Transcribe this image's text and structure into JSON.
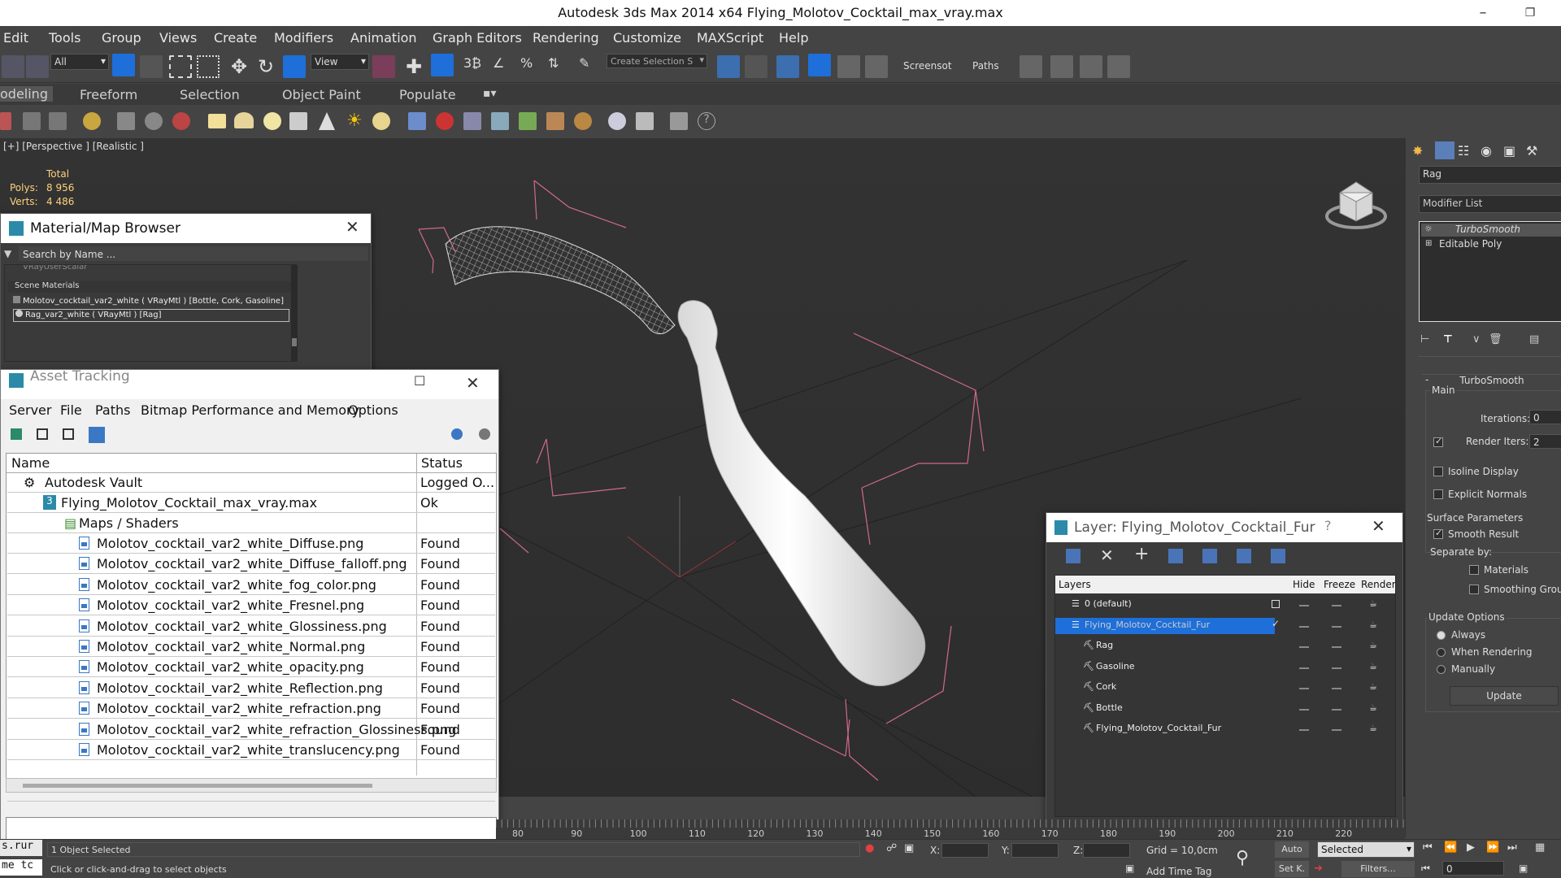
{
  "window": {
    "title": "Autodesk 3ds Max  2014 x64      Flying_Molotov_Cocktail_max_vray.max"
  },
  "menu": [
    "Edit",
    "Tools",
    "Group",
    "Views",
    "Create",
    "Modifiers",
    "Animation",
    "Graph Editors",
    "Rendering",
    "Customize",
    "MAXScript",
    "Help"
  ],
  "toolbar": {
    "filter": "All",
    "ref_coord": "View",
    "selection_set_placeholder": "Create Selection S",
    "screenshot_label": "Screensot",
    "paths_label": "Paths"
  },
  "ribbon_tabs": [
    "odeling",
    "Freeform",
    "Selection",
    "Object Paint",
    "Populate"
  ],
  "viewport": {
    "label": "[+] [Perspective ] [Realistic ]",
    "stats_total": "Total",
    "polys_label": "Polys:",
    "polys": "8 956",
    "verts_label": "Verts:",
    "verts": "4 486"
  },
  "material_browser": {
    "title": "Material/Map Browser",
    "search_placeholder": "Search by Name ...",
    "truncated_item": "VRayUserScalar",
    "group": "Scene Materials",
    "items": [
      "Molotov_cocktail_var2_white ( VRayMtl ) [Bottle, Cork, Gasoline]",
      "Rag_var2_white ( VRayMtl ) [Rag]"
    ]
  },
  "asset_tracking": {
    "title": "Asset Tracking",
    "menu": [
      "Server",
      "File",
      "Paths",
      "Bitmap Performance and Memory",
      "Options"
    ],
    "col_name": "Name",
    "col_status": "Status",
    "vault": {
      "name": "Autodesk Vault",
      "status": "Logged O..."
    },
    "file": {
      "name": "Flying_Molotov_Cocktail_max_vray.max",
      "status": "Ok"
    },
    "group": "Maps / Shaders",
    "maps": [
      {
        "name": "Molotov_cocktail_var2_white_Diffuse.png",
        "status": "Found"
      },
      {
        "name": "Molotov_cocktail_var2_white_Diffuse_falloff.png",
        "status": "Found"
      },
      {
        "name": "Molotov_cocktail_var2_white_fog_color.png",
        "status": "Found"
      },
      {
        "name": "Molotov_cocktail_var2_white_Fresnel.png",
        "status": "Found"
      },
      {
        "name": "Molotov_cocktail_var2_white_Glossiness.png",
        "status": "Found"
      },
      {
        "name": "Molotov_cocktail_var2_white_Normal.png",
        "status": "Found"
      },
      {
        "name": "Molotov_cocktail_var2_white_opacity.png",
        "status": "Found"
      },
      {
        "name": "Molotov_cocktail_var2_white_Reflection.png",
        "status": "Found"
      },
      {
        "name": "Molotov_cocktail_var2_white_refraction.png",
        "status": "Found"
      },
      {
        "name": "Molotov_cocktail_var2_white_refraction_Glossiness.png",
        "status": "Found"
      },
      {
        "name": "Molotov_cocktail_var2_white_translucency.png",
        "status": "Found"
      }
    ]
  },
  "layer_dialog": {
    "title": "Layer: Flying_Molotov_Cocktail_Fur",
    "help": "?",
    "col_layers": "Layers",
    "col_hide": "Hide",
    "col_freeze": "Freeze",
    "col_render": "Render",
    "layers": [
      "0 (default)",
      "Flying_Molotov_Cocktail_Fur",
      "Rag",
      "Gasoline",
      "Cork",
      "Bottle",
      "Flying_Molotov_Cocktail_Fur"
    ]
  },
  "command_panel": {
    "object_name": "Rag",
    "modifier_list": "Modifier List",
    "stack": [
      "TurboSmooth",
      "Editable Poly"
    ],
    "rollout_title": "TurboSmooth",
    "main": "Main",
    "iterations_label": "Iterations:",
    "iterations": "0",
    "render_iters_label": "Render Iters:",
    "render_iters": "2",
    "isoline": "Isoline Display",
    "explicit_normals": "Explicit Normals",
    "surface_params": "Surface Parameters",
    "smooth_result": "Smooth Result",
    "separate_by": "Separate by:",
    "materials": "Materials",
    "smoothing_groups": "Smoothing Groups",
    "update_options": "Update Options",
    "always": "Always",
    "when_rendering": "When Rendering",
    "manually": "Manually",
    "update_button": "Update"
  },
  "timeline_ticks": [
    "80",
    "90",
    "100",
    "110",
    "120",
    "130",
    "140",
    "150",
    "160",
    "170",
    "180",
    "190",
    "200",
    "210",
    "220"
  ],
  "status": {
    "script_top": "s.rur",
    "script_bottom": "me tc",
    "selected_text": "1 Object Selected",
    "prompt": "Click or click-and-drag to select objects",
    "x_label": "X:",
    "y_label": "Y:",
    "z_label": "Z:",
    "grid": "Grid = 10,0cm",
    "add_time_tag": "Add Time Tag",
    "auto": "Auto",
    "set_key": "Set K.",
    "selected_dropdown": "Selected",
    "filters": "Filters...",
    "frame": "0"
  },
  "colors": {
    "bg": "#444444",
    "viewport": "#2f2f2f",
    "selection": "#1e6fd9",
    "bounds": "#d06a88"
  }
}
